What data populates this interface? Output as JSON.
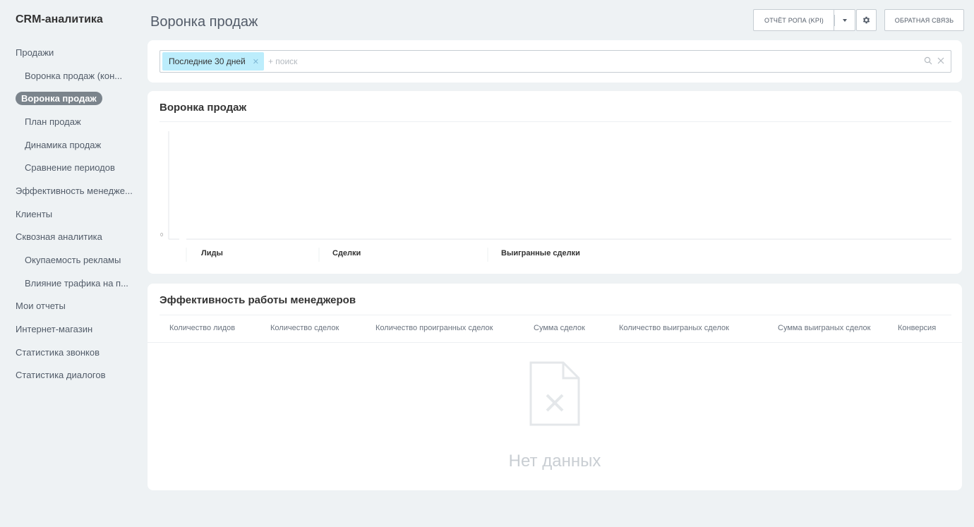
{
  "sidebar": {
    "app_title": "CRM-аналитика",
    "items": [
      {
        "label": "Продажи",
        "level": 0,
        "active": false
      },
      {
        "label": "Воронка продаж (кон...",
        "level": 1,
        "active": false
      },
      {
        "label": "Воронка продаж",
        "level": 1,
        "active": true
      },
      {
        "label": "План продаж",
        "level": 1,
        "active": false
      },
      {
        "label": "Динамика продаж",
        "level": 1,
        "active": false
      },
      {
        "label": "Сравнение периодов",
        "level": 1,
        "active": false
      },
      {
        "label": "Эффективность менедже...",
        "level": 0,
        "active": false
      },
      {
        "label": "Клиенты",
        "level": 0,
        "active": false
      },
      {
        "label": "Сквозная аналитика",
        "level": 0,
        "active": false
      },
      {
        "label": "Окупаемость рекламы",
        "level": 1,
        "active": false
      },
      {
        "label": "Влияние трафика на п...",
        "level": 1,
        "active": false
      },
      {
        "label": "Мои отчеты",
        "level": 0,
        "active": false
      },
      {
        "label": "Интернет-магазин",
        "level": 0,
        "active": false
      },
      {
        "label": "Статистика звонков",
        "level": 0,
        "active": false
      },
      {
        "label": "Статистика диалогов",
        "level": 0,
        "active": false
      }
    ]
  },
  "header": {
    "title": "Воронка продаж",
    "kpi_button": "ОТЧЁТ РОПА (KPI)",
    "feedback_button": "ОБРАТНАЯ СВЯЗЬ",
    "gear_icon": "gear-icon",
    "dropdown_icon": "chevron-down-icon"
  },
  "filter": {
    "tag_label": "Последние 30 дней",
    "search_placeholder": "+ поиск",
    "search_icon": "search-icon",
    "clear_icon": "close-icon"
  },
  "funnel": {
    "title": "Воронка продаж"
  },
  "chart_data": {
    "type": "bar",
    "title": "Воронка продаж",
    "categories": [
      "Лиды",
      "Сделки",
      "Выигранные сделки"
    ],
    "values": [
      0,
      0,
      0
    ],
    "y_ticks": [
      "0"
    ],
    "ylim": [
      0,
      0
    ],
    "grid": false
  },
  "managers": {
    "title": "Эффективность работы менеджеров",
    "columns": [
      "Количество лидов",
      "Количество сделок",
      "Количество проигранных сделок",
      "Сумма сделок",
      "Количество выиграных сделок",
      "Сумма выиграных сделок",
      "Конверсия"
    ],
    "rows": [],
    "empty_text": "Нет данных",
    "empty_icon": "no-data-file-icon"
  },
  "colors": {
    "background": "#eef2f4",
    "tag": "#bcedfc",
    "active_pill": "#7b848c"
  }
}
